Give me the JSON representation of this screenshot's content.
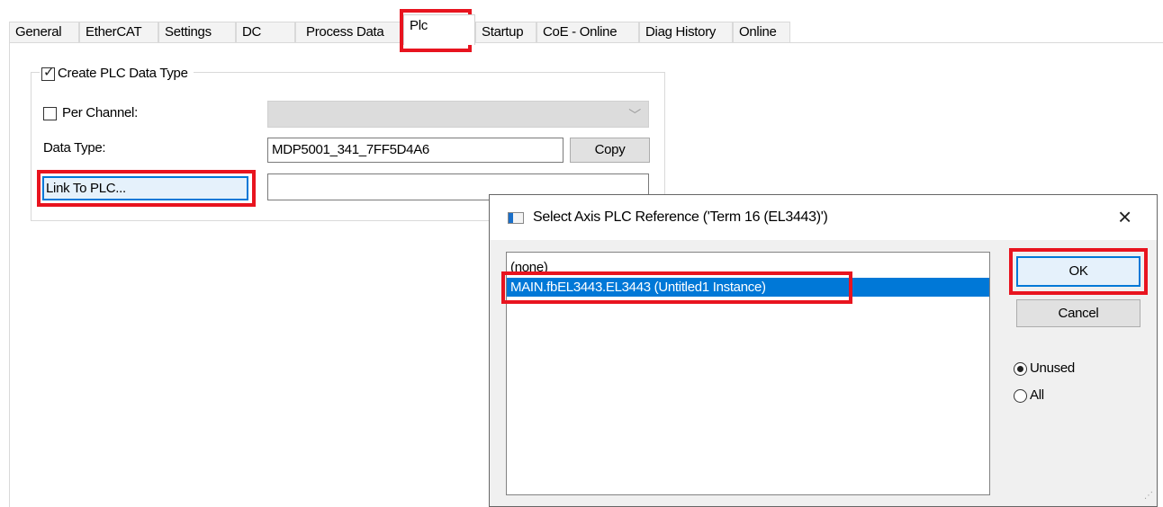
{
  "tabs": [
    {
      "label": "General"
    },
    {
      "label": "EtherCAT"
    },
    {
      "label": "Settings"
    },
    {
      "label": "DC"
    },
    {
      "label": "Process Data"
    },
    {
      "label": "Plc"
    },
    {
      "label": "Startup"
    },
    {
      "label": "CoE - Online"
    },
    {
      "label": "Diag History"
    },
    {
      "label": "Online"
    }
  ],
  "plc_group": {
    "create_type_label": "Create PLC Data Type",
    "create_type_checked": true,
    "per_channel_label": "Per Channel:",
    "per_channel_checked": false,
    "data_type_label": "Data Type:",
    "data_type_value": "MDP5001_341_7FF5D4A6",
    "copy_label": "Copy",
    "link_button_label": "Link To PLC...",
    "link_value": ""
  },
  "dialog": {
    "title": "Select Axis PLC Reference ('Term 16 (EL3443)')",
    "close_glyph": "×",
    "list_items": [
      "(none)",
      "MAIN.fbEL3443.EL3443 (Untitled1 Instance)"
    ],
    "selected_index": 1,
    "ok_label": "OK",
    "cancel_label": "Cancel",
    "filter_options": [
      "Unused",
      "All"
    ],
    "filter_selected": "Unused"
  },
  "highlight_color": "#e8141f"
}
